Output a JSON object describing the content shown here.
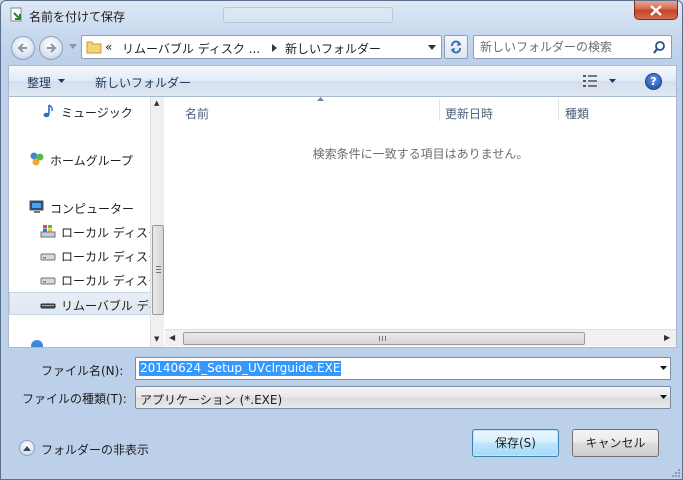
{
  "window": {
    "title": "名前を付けて保存"
  },
  "address_bar": {
    "crumbs_prefix": "«",
    "crumb_1": "リムーバブル ディスク ...",
    "crumb_2": "新しいフォルダー"
  },
  "search": {
    "placeholder": "新しいフォルダーの検索"
  },
  "toolbar": {
    "organize_label": "整理",
    "new_folder_label": "新しいフォルダー"
  },
  "sidebar": {
    "items": [
      {
        "label": "ミュージック",
        "icon": "music-note-icon"
      },
      {
        "label": "ホームグループ",
        "icon": "homegroup-icon"
      },
      {
        "label": "コンピューター",
        "icon": "computer-icon"
      },
      {
        "label": "ローカル ディスク",
        "icon": "windows-drive-icon"
      },
      {
        "label": "ローカル ディスク",
        "icon": "drive-icon"
      },
      {
        "label": "ローカル ディスク",
        "icon": "drive-icon"
      },
      {
        "label": "リムーバブル ディスク",
        "icon": "removable-drive-icon",
        "selected": true
      }
    ]
  },
  "file_list": {
    "columns": [
      "名前",
      "更新日時",
      "種類"
    ],
    "empty_message": "検索条件に一致する項目はありません。"
  },
  "form": {
    "filename_label": "ファイル名(N):",
    "filename_value": "20140624_Setup_UVclrguide.EXE",
    "filetype_label": "ファイルの種類(T):",
    "filetype_value": "アプリケーション (*.EXE)"
  },
  "footer": {
    "hide_folders_label": "フォルダーの非表示",
    "save_label": "保存(S)",
    "cancel_label": "キャンセル"
  },
  "colors": {
    "selection": "#3399ff",
    "close_button": "#c3422a",
    "help_button": "#2a5cb5"
  }
}
